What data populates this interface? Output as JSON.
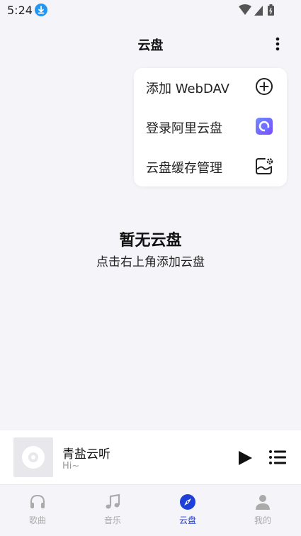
{
  "status_bar": {
    "time": "5:24"
  },
  "app_bar": {
    "title": "云盘"
  },
  "menu": {
    "items": [
      {
        "label": "添加 WebDAV",
        "icon": "add-circle-icon"
      },
      {
        "label": "登录阿里云盘",
        "icon": "aliyun-drive-icon"
      },
      {
        "label": "云盘缓存管理",
        "icon": "cache-settings-icon"
      }
    ]
  },
  "empty_state": {
    "title": "暂无云盘",
    "subtitle": "点击右上角添加云盘"
  },
  "player": {
    "title": "青盐云听",
    "subtitle": "Hi~"
  },
  "nav": {
    "items": [
      {
        "label": "歌曲",
        "icon": "headphones-icon"
      },
      {
        "label": "音乐",
        "icon": "music-note-icon"
      },
      {
        "label": "云盘",
        "icon": "compass-icon"
      },
      {
        "label": "我的",
        "icon": "person-icon"
      }
    ],
    "active_index": 2
  },
  "colors": {
    "accent": "#1e40d8",
    "background": "#f5f5f9",
    "inactive": "#aaaaaa"
  }
}
